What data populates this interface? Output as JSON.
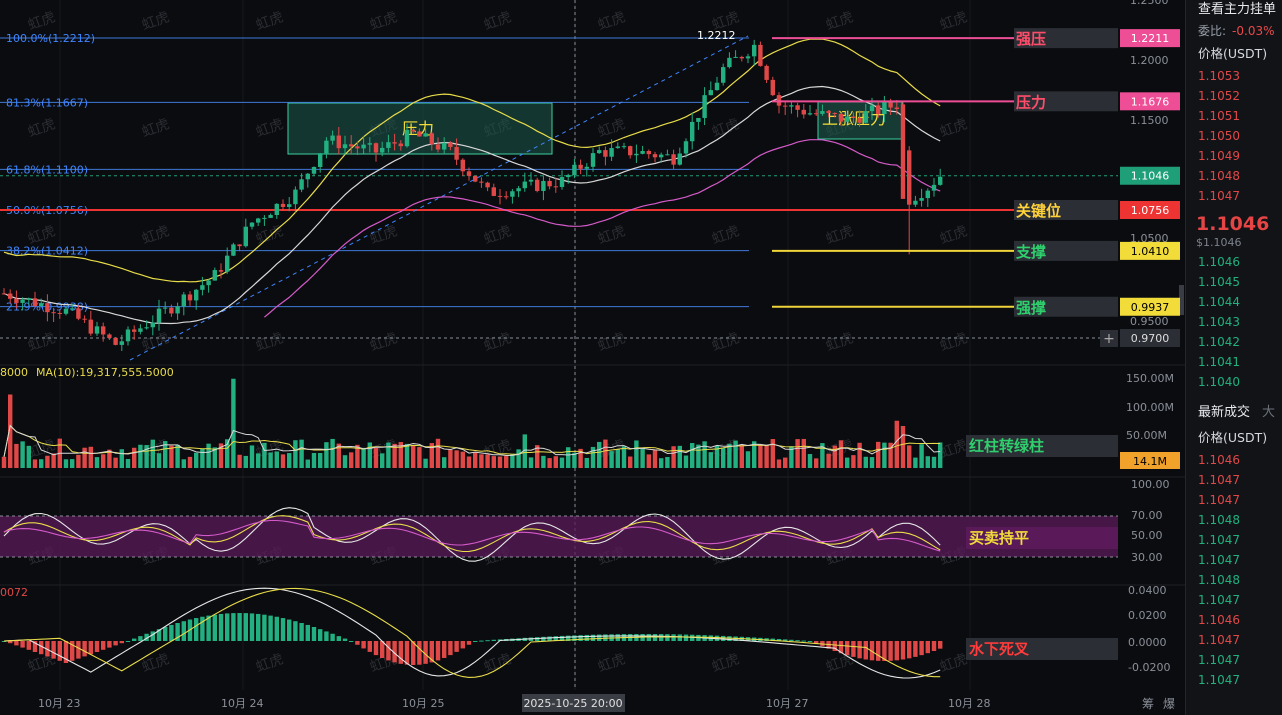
{
  "chart": {
    "fib_levels": [
      {
        "label": "100.0%(1.2212)",
        "price": 1.2212
      },
      {
        "label": "81.3%(1.1667)",
        "price": 1.1667
      },
      {
        "label": "61.8%(1.1100)",
        "price": 1.11
      },
      {
        "label": "50.0%(1.0756)",
        "price": 1.0756
      },
      {
        "label": "38.2%(1.0412)",
        "price": 1.0412
      },
      {
        "label": "21.9%(0.9938)",
        "price": 0.9938
      }
    ],
    "price_ticks": [
      "1.2500",
      "1.2000",
      "1.1500",
      "1.0500",
      "0.9500"
    ],
    "price_tags": [
      {
        "name": "strong-resistance",
        "text": "强压",
        "price_label": "1.2211",
        "price": 1.2211,
        "color": "#ee4e96",
        "tag_bg": "#ee4e96"
      },
      {
        "name": "resistance",
        "text": "压力",
        "price_label": "1.1676",
        "price": 1.1676,
        "color": "#ee4e96",
        "tag_bg": "#ee4e96"
      },
      {
        "name": "current",
        "text": "",
        "price_label": "1.1046",
        "price": 1.1046,
        "color": "#1f9f77",
        "tag_bg": "#1f9f77"
      },
      {
        "name": "key-level",
        "text": "关键位",
        "price_label": "1.0756",
        "price": 1.0756,
        "color": "#e33",
        "tag_bg": "#e33"
      },
      {
        "name": "support",
        "text": "支撑",
        "price_label": "1.0410",
        "price": 1.041,
        "color": "#f0d43a",
        "tag_bg": "#f2dc3a"
      },
      {
        "name": "strong-support",
        "text": "强撑",
        "price_label": "0.9937",
        "price": 0.9937,
        "color": "#f0d43a",
        "tag_bg": "#f2dc3a"
      }
    ],
    "crosshair_price": "0.9700",
    "high_marker": "1.2212",
    "boxes": [
      {
        "label": "压力"
      },
      {
        "label": "上涨压力"
      }
    ],
    "volume": {
      "ma_label": "MA(10):19,317,555.5000",
      "left_value": "8000",
      "ticks": [
        "150.00M",
        "100.00M",
        "50.00M"
      ],
      "tag": "14.1M",
      "annotation": "红柱转绿柱"
    },
    "rsi": {
      "ticks": [
        "100.00",
        "70.00",
        "50.00",
        "30.00"
      ],
      "annotation": "买卖持平"
    },
    "macd": {
      "ticks": [
        "0.0400",
        "0.0200",
        "0.0000",
        "-0.0200"
      ],
      "left_value": "0072",
      "annotation": "水下死叉"
    },
    "x_labels": [
      "10月 23",
      "10月 24",
      "10月 25",
      "10月 27",
      "10月 28"
    ],
    "crosshair_time": "2025-10-25 20:00",
    "corner_labels": [
      "筹",
      "爆"
    ],
    "watermark": "虹虎"
  },
  "sidebar": {
    "title": "查看主力挂单",
    "ratio_label": "委比:",
    "ratio_value": "-0.03%",
    "price_header": "价格(USDT)",
    "asks": [
      "1.1053",
      "1.1052",
      "1.1051",
      "1.1050",
      "1.1049",
      "1.1048",
      "1.1047"
    ],
    "last_price": "1.1046",
    "last_price_usd": "$1.1046",
    "bids": [
      "1.1046",
      "1.1045",
      "1.1044",
      "1.1043",
      "1.1042",
      "1.1041",
      "1.1040"
    ],
    "trades_title": "最新成交",
    "trades_tab": "大",
    "trades_header": "价格(USDT)",
    "trades": [
      {
        "p": "1.1046",
        "c": "red"
      },
      {
        "p": "1.1047",
        "c": "red"
      },
      {
        "p": "1.1047",
        "c": "red"
      },
      {
        "p": "1.1048",
        "c": "green"
      },
      {
        "p": "1.1047",
        "c": "green"
      },
      {
        "p": "1.1047",
        "c": "green"
      },
      {
        "p": "1.1048",
        "c": "green"
      },
      {
        "p": "1.1047",
        "c": "green"
      },
      {
        "p": "1.1046",
        "c": "red"
      },
      {
        "p": "1.1047",
        "c": "red"
      },
      {
        "p": "1.1047",
        "c": "green"
      },
      {
        "p": "1.1047",
        "c": "green"
      }
    ]
  }
}
